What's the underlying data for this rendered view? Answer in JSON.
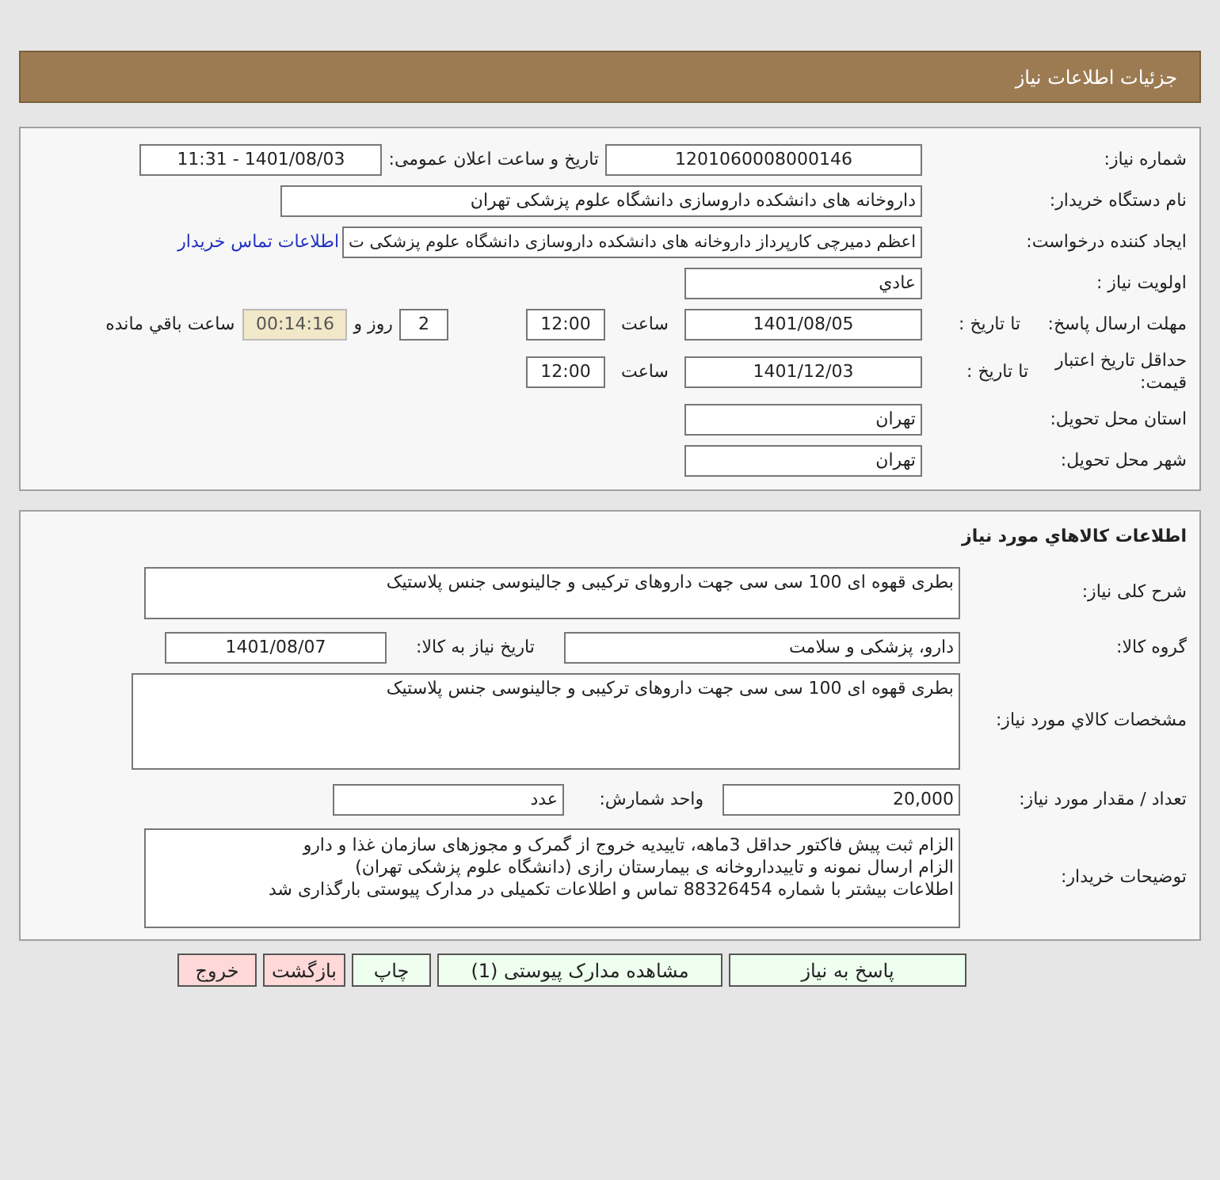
{
  "header": {
    "title": "جزئیات اطلاعات نیاز"
  },
  "need_info": {
    "number_label": "شماره نیاز:",
    "number": "1201060008000146",
    "announce_label": "تاریخ و ساعت اعلان عمومی:",
    "announce_datetime": "1401/08/03 - 11:31",
    "buyer_label": "نام دستگاه خریدار:",
    "buyer": "داروخانه های دانشکده داروسازی دانشگاه علوم پزشکی تهران",
    "requester_label": "ایجاد کننده درخواست:",
    "requester": "اعظم دمیرچی کارپرداز داروخانه های دانشکده داروسازی دانشگاه علوم پزشکی ت",
    "contact_link": "اطلاعات تماس خریدار",
    "priority_label": "اولویت نیاز :",
    "priority": "عادي",
    "deadline": {
      "label": "مهلت ارسال پاسخ:",
      "to_label": "تا تاریخ :",
      "date": "1401/08/05",
      "time_label": "ساعت",
      "time": "12:00",
      "days": "2",
      "days_label": "روز و",
      "remaining": "00:14:16",
      "remaining_label": "ساعت باقي مانده"
    },
    "validity": {
      "label": "حداقل تاریخ اعتبار قیمت:",
      "to_label": "تا تاریخ :",
      "date": "1401/12/03",
      "time_label": "ساعت",
      "time": "12:00"
    },
    "province_label": "استان محل تحویل:",
    "province": "تهران",
    "city_label": "شهر محل تحویل:",
    "city": "تهران"
  },
  "items": {
    "title": "اطلاعات کالاهاي مورد نياز",
    "description_label": "شرح کلی نیاز:",
    "description": "بطری قهوه ای 100 سی سی جهت داروهای ترکیبی و جالینوسی جنس پلاستیک",
    "group_label": "گروه کالا:",
    "group": "دارو، پزشکی و سلامت",
    "need_date_label": "تاریخ نیاز به کالا:",
    "need_date": "1401/08/07",
    "specs_label": "مشخصات کالاي مورد نياز:",
    "specs": "بطری قهوه ای 100 سی سی جهت داروهای ترکیبی و جالینوسی جنس پلاستیک",
    "quantity_label": "تعداد / مقدار مورد نیاز:",
    "quantity": "20,000",
    "unit_label": "واحد شمارش:",
    "unit": "عدد",
    "notes_label": "توضیحات خریدار:",
    "notes": [
      "الزام ثبت پیش فاکتور حداقل 3ماهه، تاییدیه خروج از گمرک و مجوزهای سازمان غذا و دارو",
      "الزام ارسال نمونه و تاییدداروخانه ی بیمارستان رازی (دانشگاه علوم پزشکی تهران)",
      "اطلاعات بیشتر با شماره 88326454 تماس و اطلاعات تکمیلی در مدارک پیوستی بارگذاری شد"
    ]
  },
  "buttons": [
    {
      "label": "پاسخ به نیاز",
      "kind": "normal"
    },
    {
      "label": "مشاهده مدارک پیوستی (1)",
      "kind": "normal"
    },
    {
      "label": "چاپ",
      "kind": "normal"
    },
    {
      "label": "بازگشت",
      "kind": "danger"
    },
    {
      "label": "خروج",
      "kind": "danger"
    }
  ]
}
